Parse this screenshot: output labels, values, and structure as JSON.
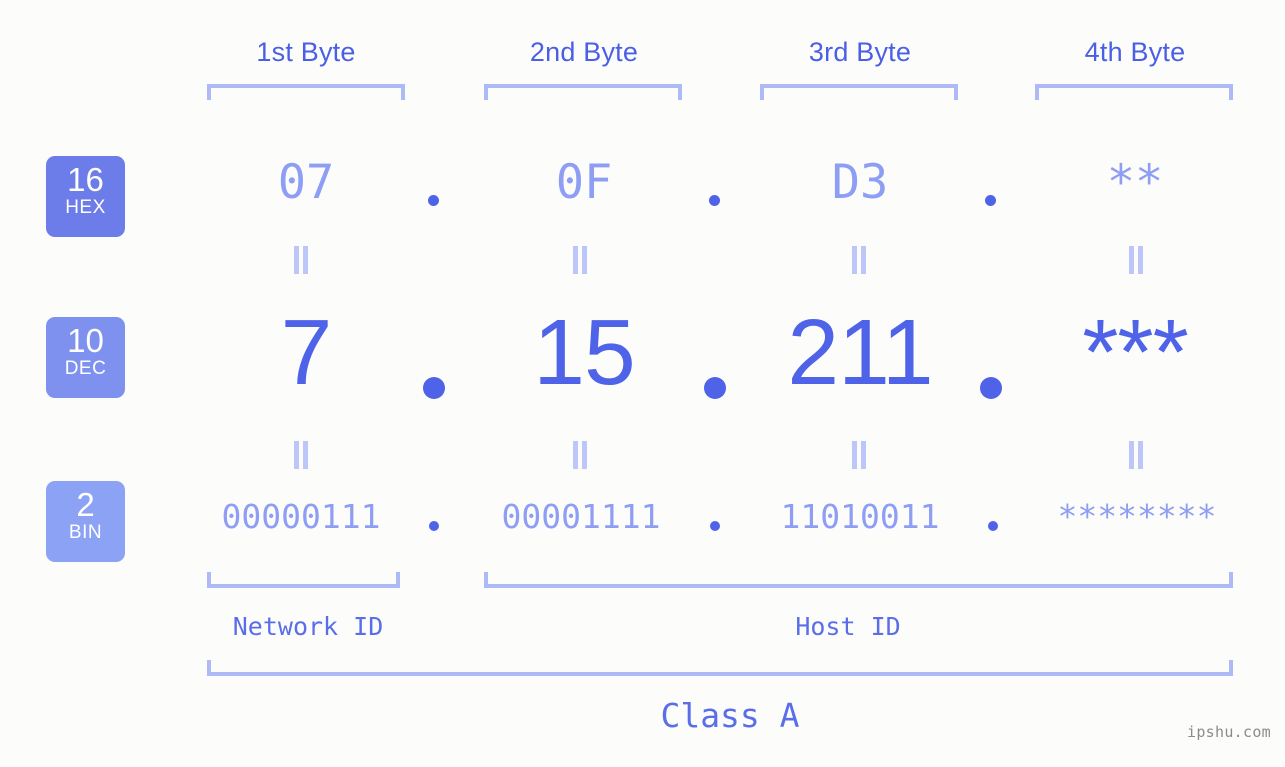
{
  "meta": {
    "site_watermark": "ipshu.com",
    "background_color": "#fcfdfa",
    "accent_strong": "#4f63e8",
    "accent_mid": "#8e9ef5",
    "accent_light": "#aebaf5"
  },
  "byte_headers": [
    {
      "label": "1st Byte"
    },
    {
      "label": "2nd Byte"
    },
    {
      "label": "3rd Byte"
    },
    {
      "label": "4th Byte"
    }
  ],
  "bases": [
    {
      "number": "16",
      "name": "HEX",
      "color": "#6c7ce8"
    },
    {
      "number": "10",
      "name": "DEC",
      "color": "#7f91ef"
    },
    {
      "number": "2",
      "name": "BIN",
      "color": "#8ca2f4"
    }
  ],
  "rows": {
    "hex": {
      "values": [
        "07",
        "0F",
        "D3",
        "**"
      ]
    },
    "dec": {
      "values": [
        "7",
        "15",
        "211",
        "***"
      ]
    },
    "bin": {
      "values": [
        "00000111",
        "00001111",
        "11010011",
        "********"
      ]
    }
  },
  "separator": ".",
  "equals_mark": "=",
  "segments": [
    {
      "label": "Network ID"
    },
    {
      "label": "Host ID"
    }
  ],
  "class": {
    "label": "Class A"
  }
}
